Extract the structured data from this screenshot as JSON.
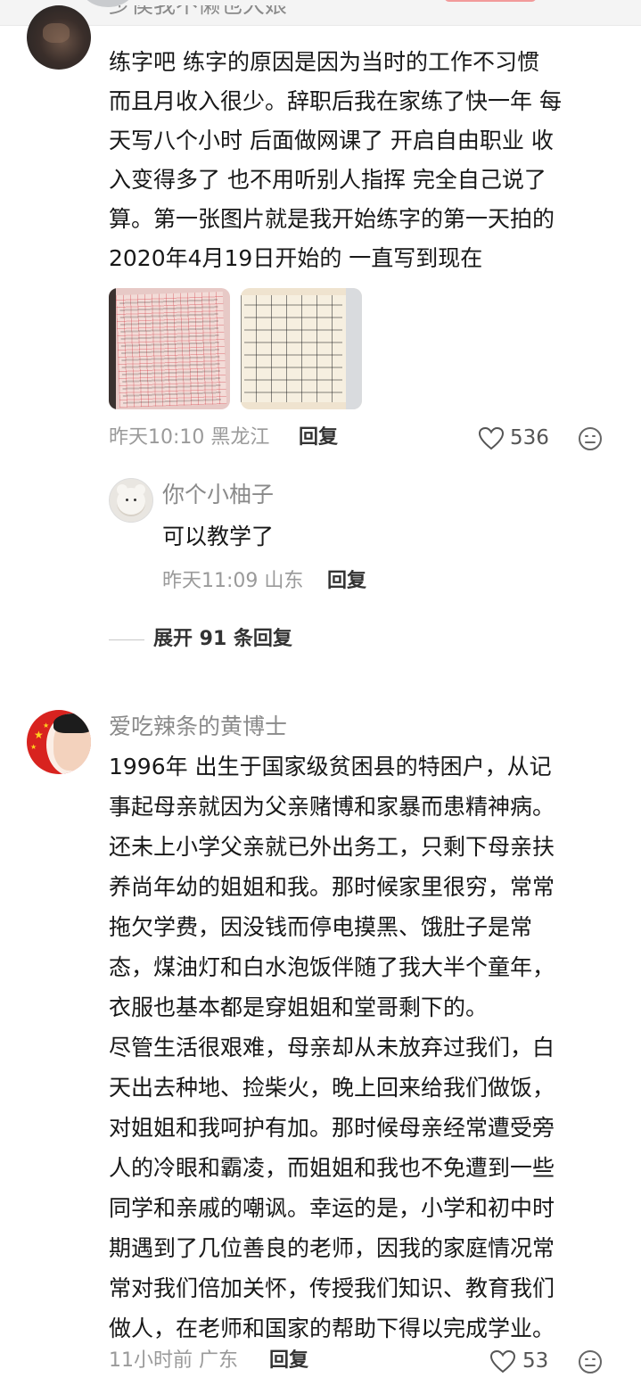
{
  "top_comment": {
    "username_partial": "少侯我不懒也大娘",
    "lines": [
      "练字吧 练字的原因是因为当时的工作不习惯",
      "而且月收入很少。辞职后我在家练了快一年 每",
      "天写八个小时 后面做网课了 开启自由职业 收",
      "入变得多了 也不用听别人指挥 完全自己说了",
      "算。第一张图片就是我开始练字的第一天拍的",
      "2020年4月19日开始的 一直写到现在"
    ],
    "meta": "昨天10:10 黑龙江",
    "reply_label": "回复",
    "likes": "536"
  },
  "sub_reply": {
    "username": "你个小柚子",
    "text": "可以教学了",
    "meta": "昨天11:09 山东",
    "reply_label": "回复"
  },
  "expand": {
    "label": "展开 91 条回复"
  },
  "main_comment": {
    "username": "爱吃辣条的黄博士",
    "lines": [
      "1996年 出生于国家级贫困县的特困户，从记",
      "事起母亲就因为父亲赌博和家暴而患精神病。",
      "还未上小学父亲就已外出务工，只剩下母亲扶",
      "养尚年幼的姐姐和我。那时候家里很穷，常常",
      "拖欠学费，因没钱而停电摸黑、饿肚子是常",
      "态，煤油灯和白水泡饭伴随了我大半个童年，",
      "衣服也基本都是穿姐姐和堂哥剩下的。",
      "尽管生活很艰难，母亲却从未放弃过我们，白",
      "天出去种地、捡柴火，晚上回来给我们做饭，",
      "对姐姐和我呵护有加。那时候母亲经常遭受旁",
      "人的冷眼和霸凌，而姐姐和我也不免遭到一些",
      "同学和亲戚的嘲讽。幸运的是，小学和初中时",
      "期遇到了几位善良的老师，因我的家庭情况常",
      "常对我们倍加关怀，传授我们知识、教育我们",
      "做人，在老师和国家的帮助下得以完成学业。"
    ],
    "meta": "11小时前 广东",
    "reply_label": "回复",
    "likes": "53"
  },
  "icons": {
    "like": "heart-outline-icon",
    "more": "emoji-face-icon"
  }
}
